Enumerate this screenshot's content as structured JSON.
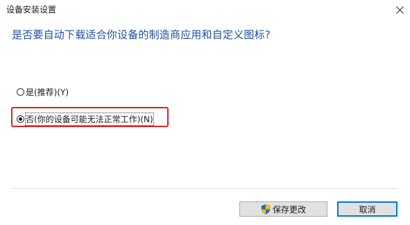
{
  "window": {
    "title": "设备安装设置"
  },
  "dialog": {
    "question": "是否要自动下载适合你设备的制造商应用和自定义图标?",
    "options": [
      {
        "label": "是(推荐)(Y)",
        "checked": false
      },
      {
        "label": "否(你的设备可能无法正常工作)(N)",
        "checked": true
      }
    ]
  },
  "buttons": {
    "save_label": "保存更改",
    "cancel_label": "取消"
  },
  "icons": {
    "close": "close-icon",
    "shield": "uac-shield-icon"
  },
  "colors": {
    "question_text": "#1e4fa6",
    "highlight": "#e02020",
    "default_button_border": "#0078d7"
  }
}
